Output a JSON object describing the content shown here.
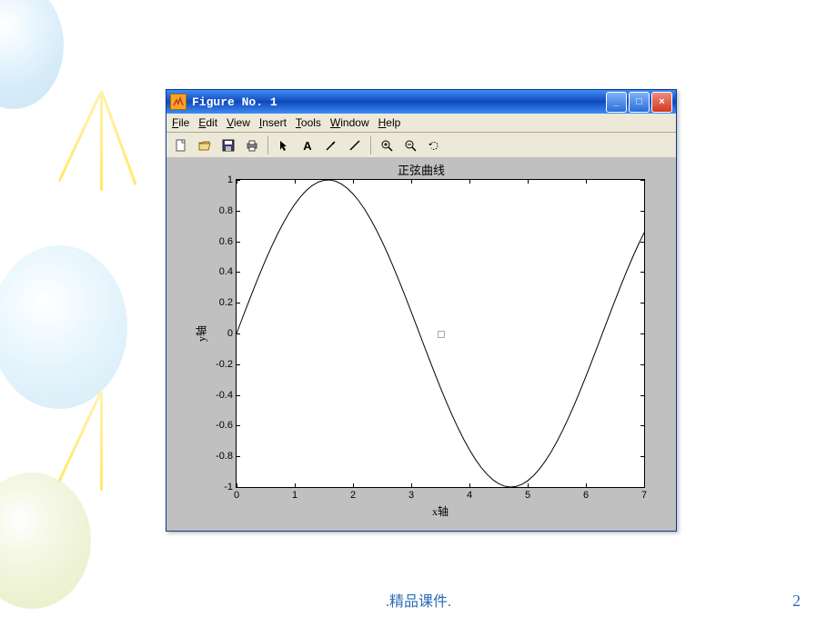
{
  "footer": {
    "text": ".精品课件.",
    "page": "2"
  },
  "window": {
    "title": "Figure No. 1",
    "menu": [
      {
        "label": "File",
        "u": "F"
      },
      {
        "label": "Edit",
        "u": "E"
      },
      {
        "label": "View",
        "u": "V"
      },
      {
        "label": "Insert",
        "u": "I"
      },
      {
        "label": "Tools",
        "u": "T"
      },
      {
        "label": "Window",
        "u": "W"
      },
      {
        "label": "Help",
        "u": "H"
      }
    ],
    "buttons": {
      "min": "_",
      "max": "□",
      "close": "×"
    }
  },
  "chart_data": {
    "type": "line",
    "title": "正弦曲线",
    "xlabel": "x轴",
    "ylabel": "y轴",
    "xlim": [
      0,
      7
    ],
    "ylim": [
      -1,
      1
    ],
    "xticks": [
      0,
      1,
      2,
      3,
      4,
      5,
      6,
      7
    ],
    "yticks": [
      -1,
      -0.8,
      -0.6,
      -0.4,
      -0.2,
      0,
      0.2,
      0.4,
      0.6,
      0.8,
      1
    ],
    "x": [
      0,
      0.1,
      0.2,
      0.3,
      0.4,
      0.5,
      0.6,
      0.7,
      0.8,
      0.9,
      1,
      1.1,
      1.2,
      1.3,
      1.4,
      1.5,
      1.6,
      1.7,
      1.8,
      1.9,
      2,
      2.1,
      2.2,
      2.3,
      2.4,
      2.5,
      2.6,
      2.7,
      2.8,
      2.9,
      3,
      3.1,
      3.2,
      3.3,
      3.4,
      3.5,
      3.6,
      3.7,
      3.8,
      3.9,
      4,
      4.1,
      4.2,
      4.3,
      4.4,
      4.5,
      4.6,
      4.7,
      4.8,
      4.9,
      5,
      5.1,
      5.2,
      5.3,
      5.4,
      5.5,
      5.6,
      5.7,
      5.8,
      5.9,
      6,
      6.1,
      6.2,
      6.3,
      6.4,
      6.5,
      6.6,
      6.7,
      6.8,
      6.9,
      7
    ],
    "values": [
      0,
      0.0998,
      0.1987,
      0.2955,
      0.3894,
      0.4794,
      0.5646,
      0.6442,
      0.7174,
      0.7833,
      0.8415,
      0.8912,
      0.932,
      0.9636,
      0.9854,
      0.9975,
      0.9996,
      0.9917,
      0.9738,
      0.9463,
      0.9093,
      0.8632,
      0.8085,
      0.7457,
      0.6755,
      0.5985,
      0.5155,
      0.4274,
      0.335,
      0.2392,
      0.1411,
      0.0416,
      -0.0584,
      -0.1577,
      -0.2555,
      -0.3508,
      -0.4425,
      -0.5298,
      -0.6119,
      -0.6878,
      -0.7568,
      -0.8183,
      -0.8716,
      -0.9162,
      -0.9516,
      -0.9775,
      -0.9937,
      -0.9999,
      -0.9962,
      -0.9825,
      -0.9589,
      -0.9258,
      -0.8835,
      -0.8323,
      -0.7728,
      -0.7055,
      -0.6313,
      -0.5507,
      -0.4646,
      -0.3739,
      -0.2794,
      -0.1822,
      -0.0831,
      0.0168,
      0.1165,
      0.215,
      0.3115,
      0.4048,
      0.4941,
      0.5784,
      0.657
    ]
  }
}
